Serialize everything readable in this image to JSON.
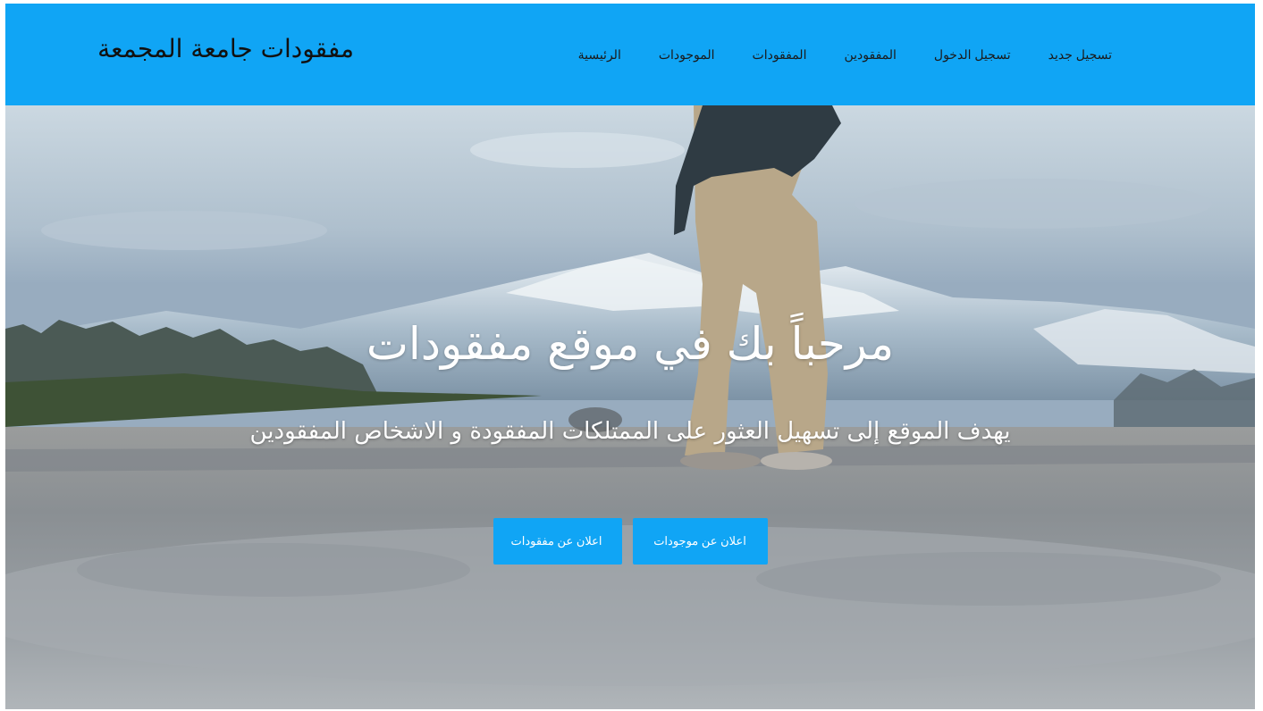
{
  "colors": {
    "brand": "#10a5f5",
    "hero_text": "#ffffff",
    "nav_text": "#1a1a1a"
  },
  "navbar": {
    "brand_title": "مفقودات جامعة المجمعة",
    "links": [
      {
        "label": "تسجيل جديد"
      },
      {
        "label": "تسجيل الدخول"
      },
      {
        "label": "المفقودين"
      },
      {
        "label": "المفقودات"
      },
      {
        "label": "الموجودات"
      },
      {
        "label": "الرئيسية"
      }
    ]
  },
  "hero": {
    "title": "مرحباً بك في موقع مفقودات",
    "subtitle": "يهدف الموقع إلى تسهيل العثور على الممتلكات المفقودة و الاشخاص المفقودين",
    "buttons": {
      "report_lost": "اعلان عن مفقودات",
      "report_found": "اعلان عن موجودات"
    }
  }
}
